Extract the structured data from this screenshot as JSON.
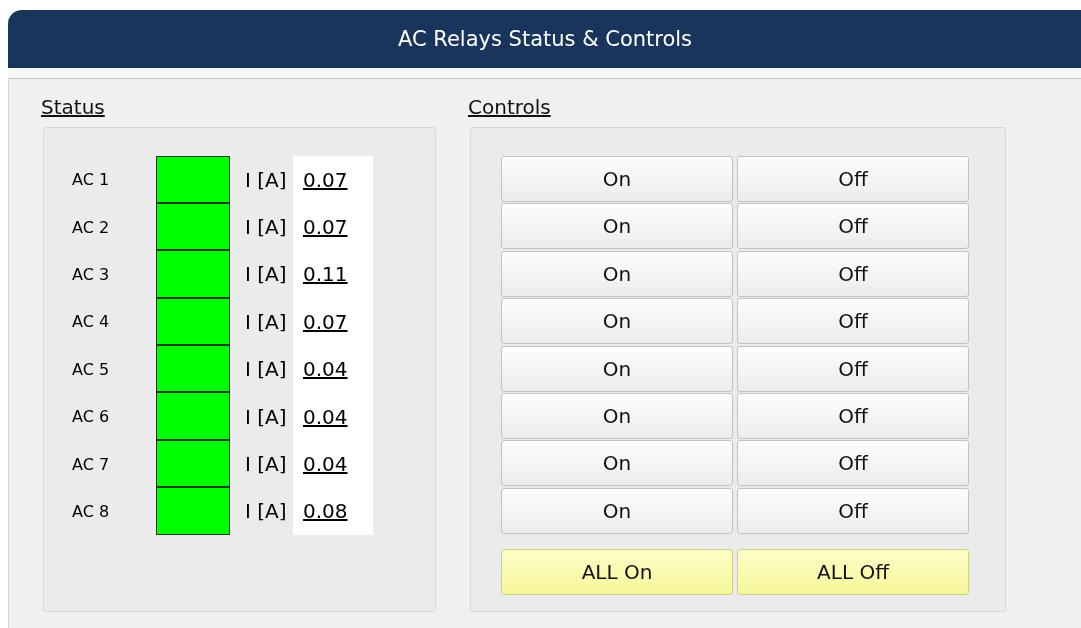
{
  "window": {
    "title": "AC Relays Status & Controls"
  },
  "status": {
    "heading": "Status",
    "relays": [
      {
        "label": "AC 1",
        "on": true,
        "unit": "I [A]",
        "current": "0.07"
      },
      {
        "label": "AC 2",
        "on": true,
        "unit": "I [A]",
        "current": "0.07"
      },
      {
        "label": "AC 3",
        "on": true,
        "unit": "I [A]",
        "current": "0.11"
      },
      {
        "label": "AC 4",
        "on": true,
        "unit": "I [A]",
        "current": "0.07"
      },
      {
        "label": "AC 5",
        "on": true,
        "unit": "I [A]",
        "current": "0.04"
      },
      {
        "label": "AC 6",
        "on": true,
        "unit": "I [A]",
        "current": "0.04"
      },
      {
        "label": "AC 7",
        "on": true,
        "unit": "I [A]",
        "current": "0.04"
      },
      {
        "label": "AC 8",
        "on": true,
        "unit": "I [A]",
        "current": "0.08"
      }
    ]
  },
  "controls": {
    "heading": "Controls",
    "rows": [
      {
        "on_label": "On",
        "off_label": "Off"
      },
      {
        "on_label": "On",
        "off_label": "Off"
      },
      {
        "on_label": "On",
        "off_label": "Off"
      },
      {
        "on_label": "On",
        "off_label": "Off"
      },
      {
        "on_label": "On",
        "off_label": "Off"
      },
      {
        "on_label": "On",
        "off_label": "Off"
      },
      {
        "on_label": "On",
        "off_label": "Off"
      },
      {
        "on_label": "On",
        "off_label": "Off"
      }
    ],
    "all_on": "ALL On",
    "all_off": "ALL Off"
  }
}
